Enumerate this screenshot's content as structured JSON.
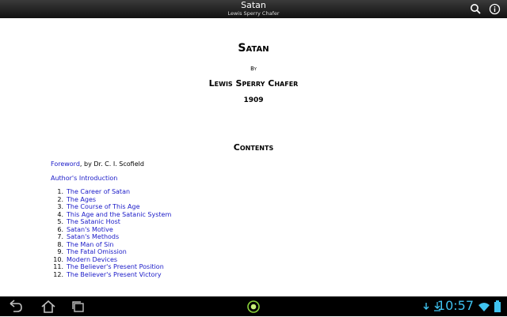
{
  "topbar": {
    "title": "Satan",
    "subtitle": "Lewis Sperry Chafer",
    "icons": [
      "search-icon",
      "info-icon"
    ]
  },
  "book": {
    "title": "Satan",
    "by": "By",
    "author": "Lewis Sperry Chafer",
    "year": "1909",
    "contents_heading": "Contents",
    "foreword_link": "Foreword",
    "foreword_suffix": ", by Dr. C. I. Scofield",
    "intro_link": "Author's Introduction",
    "chapters": [
      {
        "num": "1.",
        "title": "The Career of Satan"
      },
      {
        "num": "2.",
        "title": "The Ages"
      },
      {
        "num": "3.",
        "title": "The Course of This Age"
      },
      {
        "num": "4.",
        "title": "This Age and the Satanic System"
      },
      {
        "num": "5.",
        "title": "The Satanic Host"
      },
      {
        "num": "6.",
        "title": "Satan's Motive"
      },
      {
        "num": "7.",
        "title": "Satan's Methods"
      },
      {
        "num": "8.",
        "title": "The Man of Sin"
      },
      {
        "num": "9.",
        "title": "The Fatal Omission"
      },
      {
        "num": "10.",
        "title": "Modern Devices"
      },
      {
        "num": "11.",
        "title": "The Believer's Present Position"
      },
      {
        "num": "12.",
        "title": "The Believer's Present Victory"
      }
    ]
  },
  "navbar": {
    "clock": "10:57",
    "icons": [
      "back-icon",
      "home-icon",
      "recent-apps-icon",
      "app-notification-icon",
      "sync-icon",
      "download-icon",
      "wifi-icon",
      "battery-icon"
    ],
    "accent": "#3fc3f0"
  },
  "colors": {
    "link": "#1a1ac8",
    "background": "#ffffff"
  }
}
